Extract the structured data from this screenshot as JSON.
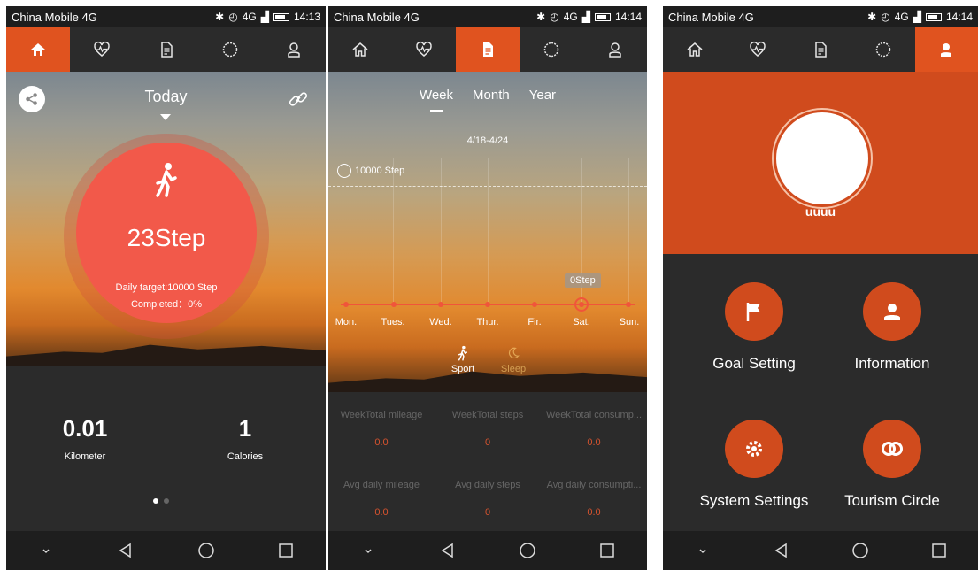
{
  "status": {
    "carrier": "China Mobile 4G",
    "net": "4G",
    "time_p1": "14:13",
    "time_p2": "14:14",
    "time_p3": "14:14"
  },
  "tabs": [
    "home-icon",
    "heart-rate-icon",
    "report-icon",
    "watch-icon",
    "user-icon"
  ],
  "p1": {
    "today": "Today",
    "steps": "23Step",
    "target": "Daily target:10000 Step",
    "completed": "Completed：0%",
    "distance_value": "0.01",
    "distance_label": "Kilometer",
    "calories_value": "1",
    "calories_label": "Calories",
    "page_index": 1,
    "page_count": 2
  },
  "p2": {
    "tabs": [
      "Week",
      "Month",
      "Year"
    ],
    "active_tab": "Week",
    "range": "4/18-4/24",
    "goal": "10000 Step",
    "bubble": "0Step",
    "days": [
      "Mon.",
      "Tues.",
      "Wed.",
      "Thur.",
      "Fir.",
      "Sat.",
      "Sun."
    ],
    "selected_day": "Sat.",
    "sport": "Sport",
    "sleep": "Sleep",
    "summary": [
      {
        "label": "WeekTotal mileage",
        "value": "0.0"
      },
      {
        "label": "WeekTotal steps",
        "value": "0"
      },
      {
        "label": "WeekTotal consump...",
        "value": "0.0"
      },
      {
        "label": "Avg daily mileage",
        "value": "0.0"
      },
      {
        "label": "Avg daily steps",
        "value": "0"
      },
      {
        "label": "Avg daily consumpti...",
        "value": "0.0"
      }
    ]
  },
  "p3": {
    "username": "uuuu",
    "goal": "Goal Setting",
    "info": "Information",
    "settings": "System Settings",
    "tourism": "Tourism Circle"
  },
  "colors": {
    "accent": "#e0531f",
    "ring": "#f2594a",
    "dark": "#2b2b2b"
  }
}
